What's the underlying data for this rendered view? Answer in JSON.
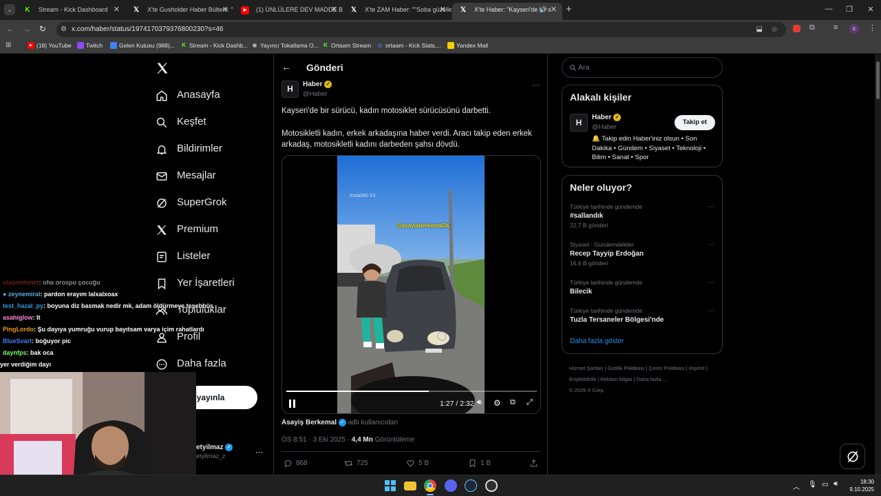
{
  "browser": {
    "tabs": [
      {
        "title": "Stream - Kick Dashboard",
        "icon": "kick-icon"
      },
      {
        "title": "X'te Gusholder Haber Bülteni: \"",
        "icon": "x-icon"
      },
      {
        "title": "(1) ÜNLÜLERE DEV MADDE BA",
        "icon": "youtube-icon"
      },
      {
        "title": "X'te ZAM Haber: \"\"Soba güzelle",
        "icon": "x-icon"
      },
      {
        "title": "X'te Haber: \"Kayseri'de bir s",
        "icon": "x-icon"
      }
    ],
    "url": "x.com/haber/status/1974170379376800230?s=46",
    "bookmarks": [
      {
        "label": "(18) YouTube",
        "color": "#ff0000"
      },
      {
        "label": "Twitch",
        "color": "#9146ff"
      },
      {
        "label": "Gelen Kutusu (988)...",
        "color": "#3b82f6"
      },
      {
        "label": "Stream - Kick Dashb...",
        "color": "#53fc18"
      },
      {
        "label": "Yayıncı Tokatlama O...",
        "color": "#888888"
      },
      {
        "label": "Ortaam Stream",
        "color": "#53fc18"
      },
      {
        "label": "ortaam - Kick Stats,...",
        "color": "#6b7cff"
      },
      {
        "label": "Yandex Mail",
        "color": "#ffcc00"
      }
    ]
  },
  "sidebar": {
    "items": [
      {
        "label": "Anasayfa",
        "icon": "home-icon"
      },
      {
        "label": "Keşfet",
        "icon": "search-icon"
      },
      {
        "label": "Bildirimler",
        "icon": "bell-icon"
      },
      {
        "label": "Mesajlar",
        "icon": "mail-icon"
      },
      {
        "label": "SuperGrok",
        "icon": "grok-icon"
      },
      {
        "label": "Premium",
        "icon": "x-icon"
      },
      {
        "label": "Listeler",
        "icon": "list-icon"
      },
      {
        "label": "Yer İşaretleri",
        "icon": "bookmark-icon"
      },
      {
        "label": "Topluluklar",
        "icon": "people-icon"
      },
      {
        "label": "Profil",
        "icon": "person-icon"
      },
      {
        "label": "Daha fazla",
        "icon": "more-circle-icon"
      }
    ],
    "post_button": "eri yayınla",
    "account_name": "etyilmaz",
    "account_handle": "etyilmaz_z"
  },
  "post": {
    "header": "Gönderi",
    "author_name": "Haber",
    "author_handle": "@Haber",
    "text1": "Kayseri'de bir sürücü, kadın motosiklet sürücüsünü darbetti.",
    "text2": "Motosikletli kadın, erkek arkadaşına haber verdi. Aracı takip eden erkek arkadaş, motosikletli kadını darbeden şahsı dövdü.",
    "video": {
      "watermark": "Insta360 X3",
      "tag": "@asayisberkemal34_",
      "time": "1:27 / 2:32",
      "progress": 0.57
    },
    "source_name": "Asayiş Berkemal",
    "source_suffix": "adlı kullanıcıdan",
    "time": "ÖS 8:51 · 3 Eki 2025 ·",
    "views": "4,4 Mn",
    "views_label": "Görüntüleme",
    "replies": "868",
    "reposts": "725",
    "likes": "5 B",
    "bookmarks": "1 B"
  },
  "right": {
    "search_placeholder": "Ara",
    "related_title": "Alakalı kişiler",
    "related_name": "Haber",
    "related_handle": "@Haber",
    "follow_button": "Takip et",
    "related_bio": "🔔 Takip edin Haber'iniz olsun • Son Dakika • Gündem • Siyaset • Teknoloji • Bilim • Sanat • Spor",
    "trends_title": "Neler oluyor?",
    "trends": [
      {
        "context": "Türkiye tarihinde gündemde",
        "title": "#sallandık",
        "count": "22,7 B gönderi"
      },
      {
        "context": "Siyaset · Gündemdekiler",
        "title": "Recep Tayyip Erdoğan",
        "count": "16,6 B gönderi"
      },
      {
        "context": "Türkiye tarihinde gündemde",
        "title": "Bilecik",
        "count": ""
      },
      {
        "context": "Türkiye tarihinde gündemde",
        "title": "Tuzla Tersaneler Bölgesi'nde",
        "count": ""
      }
    ],
    "show_more": "Daha fazla göster",
    "footer": [
      "Hizmet Şartları",
      "Gizlilik Politikası",
      "Çerez Politikası",
      "Imprint",
      "Erişilebilirlik",
      "Reklam bilgisi",
      "Daha fazla ..."
    ],
    "copyright": "© 2025 X Corp."
  },
  "chat": [
    {
      "user": "ulaşmehmet",
      "msg": ": oha orospu çocuğu",
      "color": "#c0392b"
    },
    {
      "user": "zeynemiral",
      "msg": ": pardon erayım lalxalxoax",
      "color": "#5dade2"
    },
    {
      "user": "test_hazal_py",
      "msg": ": boyuna diz basmak nedir mk, adam öldürmeye teşebbüs",
      "color": "#3498db"
    },
    {
      "user": "asahiglow",
      "msg": ": It",
      "color": "#ff8ad8"
    },
    {
      "user": "PingLordo",
      "msg": ": Şu dayıya yumruğu vurup bayıtsam varya içim rahatlardı",
      "color": "#f39c12"
    },
    {
      "user": "BlueSvart",
      "msg": ": boğuyor pic",
      "color": "#3b82f6"
    },
    {
      "user": "daynfps",
      "msg": ": bak oca",
      "color": "#7dff6b"
    },
    {
      "user": "",
      "msg": "yer verdiğim dayı",
      "color": "#ffffff"
    }
  ],
  "system": {
    "time": "18:30",
    "date": "9.10.2025"
  }
}
